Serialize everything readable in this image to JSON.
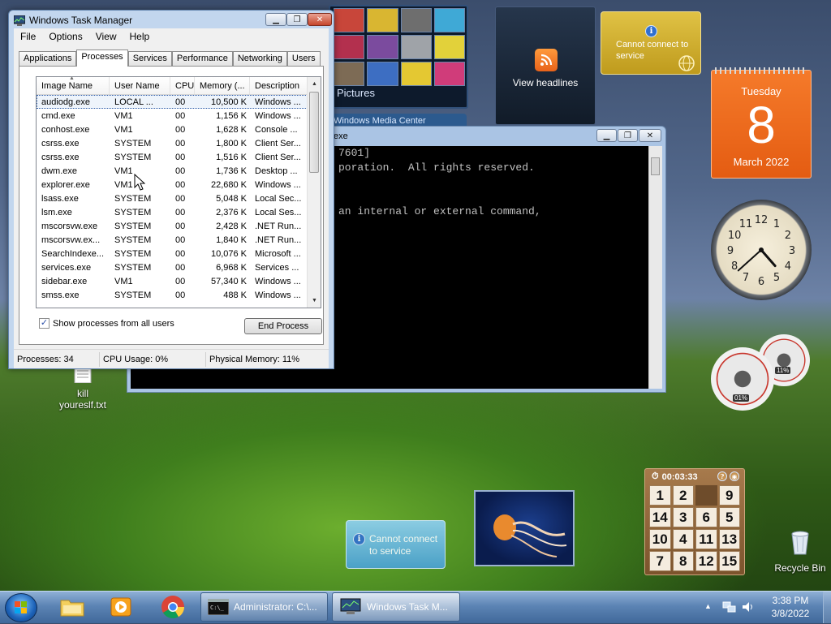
{
  "desktop": {
    "icons": [
      {
        "label": "kill\nyoureslf.txt"
      },
      {
        "label": "Recycle Bin"
      }
    ]
  },
  "gadgets": {
    "media_center": {
      "label": "Pictures",
      "bar_label": "Windows Media Center"
    },
    "feed_headlines": {
      "label": "View headlines"
    },
    "weather": {
      "message": "Cannot connect to service"
    },
    "weather_bottom": {
      "message": "Cannot connect to service"
    },
    "calendar": {
      "weekday": "Tuesday",
      "day": "8",
      "month_year": "March 2022"
    },
    "clock": {
      "hour": 4,
      "minute": 38
    },
    "cpu_meter": {
      "cpu": "01%",
      "memory": "11%"
    },
    "puzzle": {
      "time": "00:03:33",
      "tiles": [
        "1",
        "2",
        "",
        "9",
        "14",
        "3",
        "6",
        "5",
        "10",
        "4",
        "11",
        "13",
        "7",
        "8",
        "12",
        "15"
      ]
    }
  },
  "cmd_window": {
    "title": "Administrator: C:\\Windows\\system32\\cmd.exe",
    "title_visible": "exe",
    "lines": [
      "7601]",
      "poration.  All rights reserved.",
      "",
      "",
      "an internal or external command,"
    ]
  },
  "task_manager": {
    "title": "Windows Task Manager",
    "menu": [
      "File",
      "Options",
      "View",
      "Help"
    ],
    "tabs": [
      "Applications",
      "Processes",
      "Services",
      "Performance",
      "Networking",
      "Users"
    ],
    "active_tab": 1,
    "columns": [
      "Image Name",
      "User Name",
      "CPU",
      "Memory (...",
      "Description"
    ],
    "rows": [
      [
        "audiodg.exe",
        "LOCAL ...",
        "00",
        "10,500 K",
        "Windows ..."
      ],
      [
        "cmd.exe",
        "VM1",
        "00",
        "1,156 K",
        "Windows ..."
      ],
      [
        "conhost.exe",
        "VM1",
        "00",
        "1,628 K",
        "Console ..."
      ],
      [
        "csrss.exe",
        "SYSTEM",
        "00",
        "1,800 K",
        "Client Ser..."
      ],
      [
        "csrss.exe",
        "SYSTEM",
        "00",
        "1,516 K",
        "Client Ser..."
      ],
      [
        "dwm.exe",
        "VM1",
        "00",
        "1,736 K",
        "Desktop ..."
      ],
      [
        "explorer.exe",
        "VM1",
        "00",
        "22,680 K",
        "Windows ..."
      ],
      [
        "lsass.exe",
        "SYSTEM",
        "00",
        "5,048 K",
        "Local Sec..."
      ],
      [
        "lsm.exe",
        "SYSTEM",
        "00",
        "2,376 K",
        "Local Ses..."
      ],
      [
        "mscorsvw.exe",
        "SYSTEM",
        "00",
        "2,428 K",
        ".NET Run..."
      ],
      [
        "mscorsvw.ex...",
        "SYSTEM",
        "00",
        "1,840 K",
        ".NET Run..."
      ],
      [
        "SearchIndexe...",
        "SYSTEM",
        "00",
        "10,076 K",
        "Microsoft ..."
      ],
      [
        "services.exe",
        "SYSTEM",
        "00",
        "6,968 K",
        "Services ..."
      ],
      [
        "sidebar.exe",
        "VM1",
        "00",
        "57,340 K",
        "Windows ..."
      ],
      [
        "smss.exe",
        "SYSTEM",
        "00",
        "488 K",
        "Windows ..."
      ]
    ],
    "show_all_label": "Show processes from all users",
    "show_all_checked": true,
    "end_process_label": "End Process",
    "status": {
      "processes": "Processes: 34",
      "cpu": "CPU Usage: 0%",
      "memory": "Physical Memory: 11%"
    }
  },
  "taskbar": {
    "buttons": [
      {
        "label": "Administrator: C:\\..."
      },
      {
        "label": "Windows Task M..."
      }
    ],
    "time": "3:38 PM",
    "date": "3/8/2022"
  }
}
